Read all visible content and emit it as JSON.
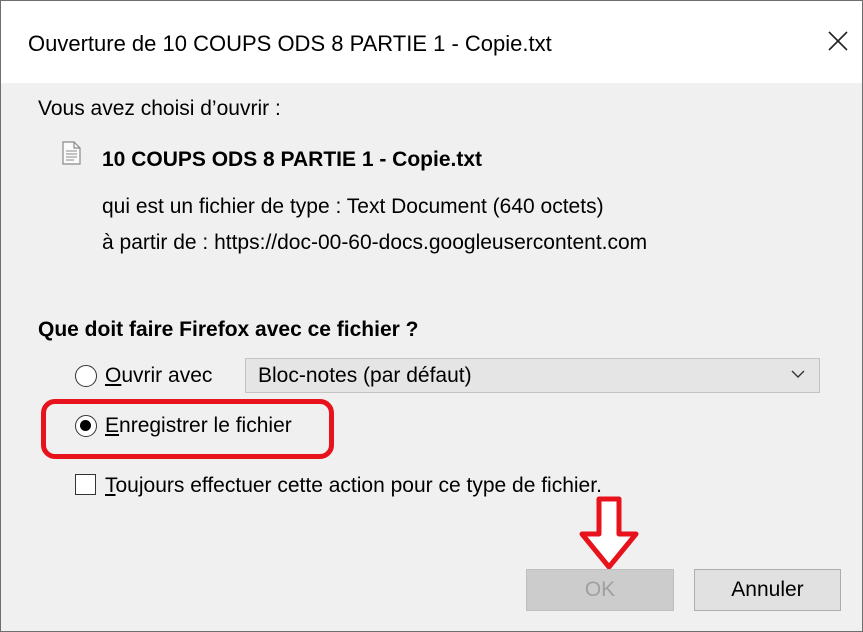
{
  "dialog": {
    "title": "Ouverture de 10 COUPS ODS 8 PARTIE 1 - Copie.txt",
    "close_icon": "close-icon"
  },
  "intro": "Vous avez choisi d’ouvrir :",
  "file": {
    "icon": "text-file-icon",
    "name": "10 COUPS ODS 8 PARTIE 1 - Copie.txt",
    "type_label": "qui est un fichier de type :",
    "type_value": "Text Document (640 octets)",
    "source_label": "à partir de :",
    "source_value": "https://doc-00-60-docs.googleusercontent.com"
  },
  "question": "Que doit faire Firefox avec ce fichier ?",
  "options": {
    "open_with": {
      "mnemonic": "O",
      "rest": "uvrir avec",
      "selected": false,
      "app": "Bloc-notes (par défaut)"
    },
    "save": {
      "mnemonic": "E",
      "rest": "nregistrer le fichier",
      "selected": true
    },
    "always": {
      "mnemonic": "T",
      "rest": "oujours effectuer cette action pour ce type de fichier.",
      "checked": false
    }
  },
  "buttons": {
    "ok": "OK",
    "cancel": "Annuler"
  },
  "annotations": {
    "highlight_color": "#e8121c",
    "arrow_color": "#e8121c"
  }
}
